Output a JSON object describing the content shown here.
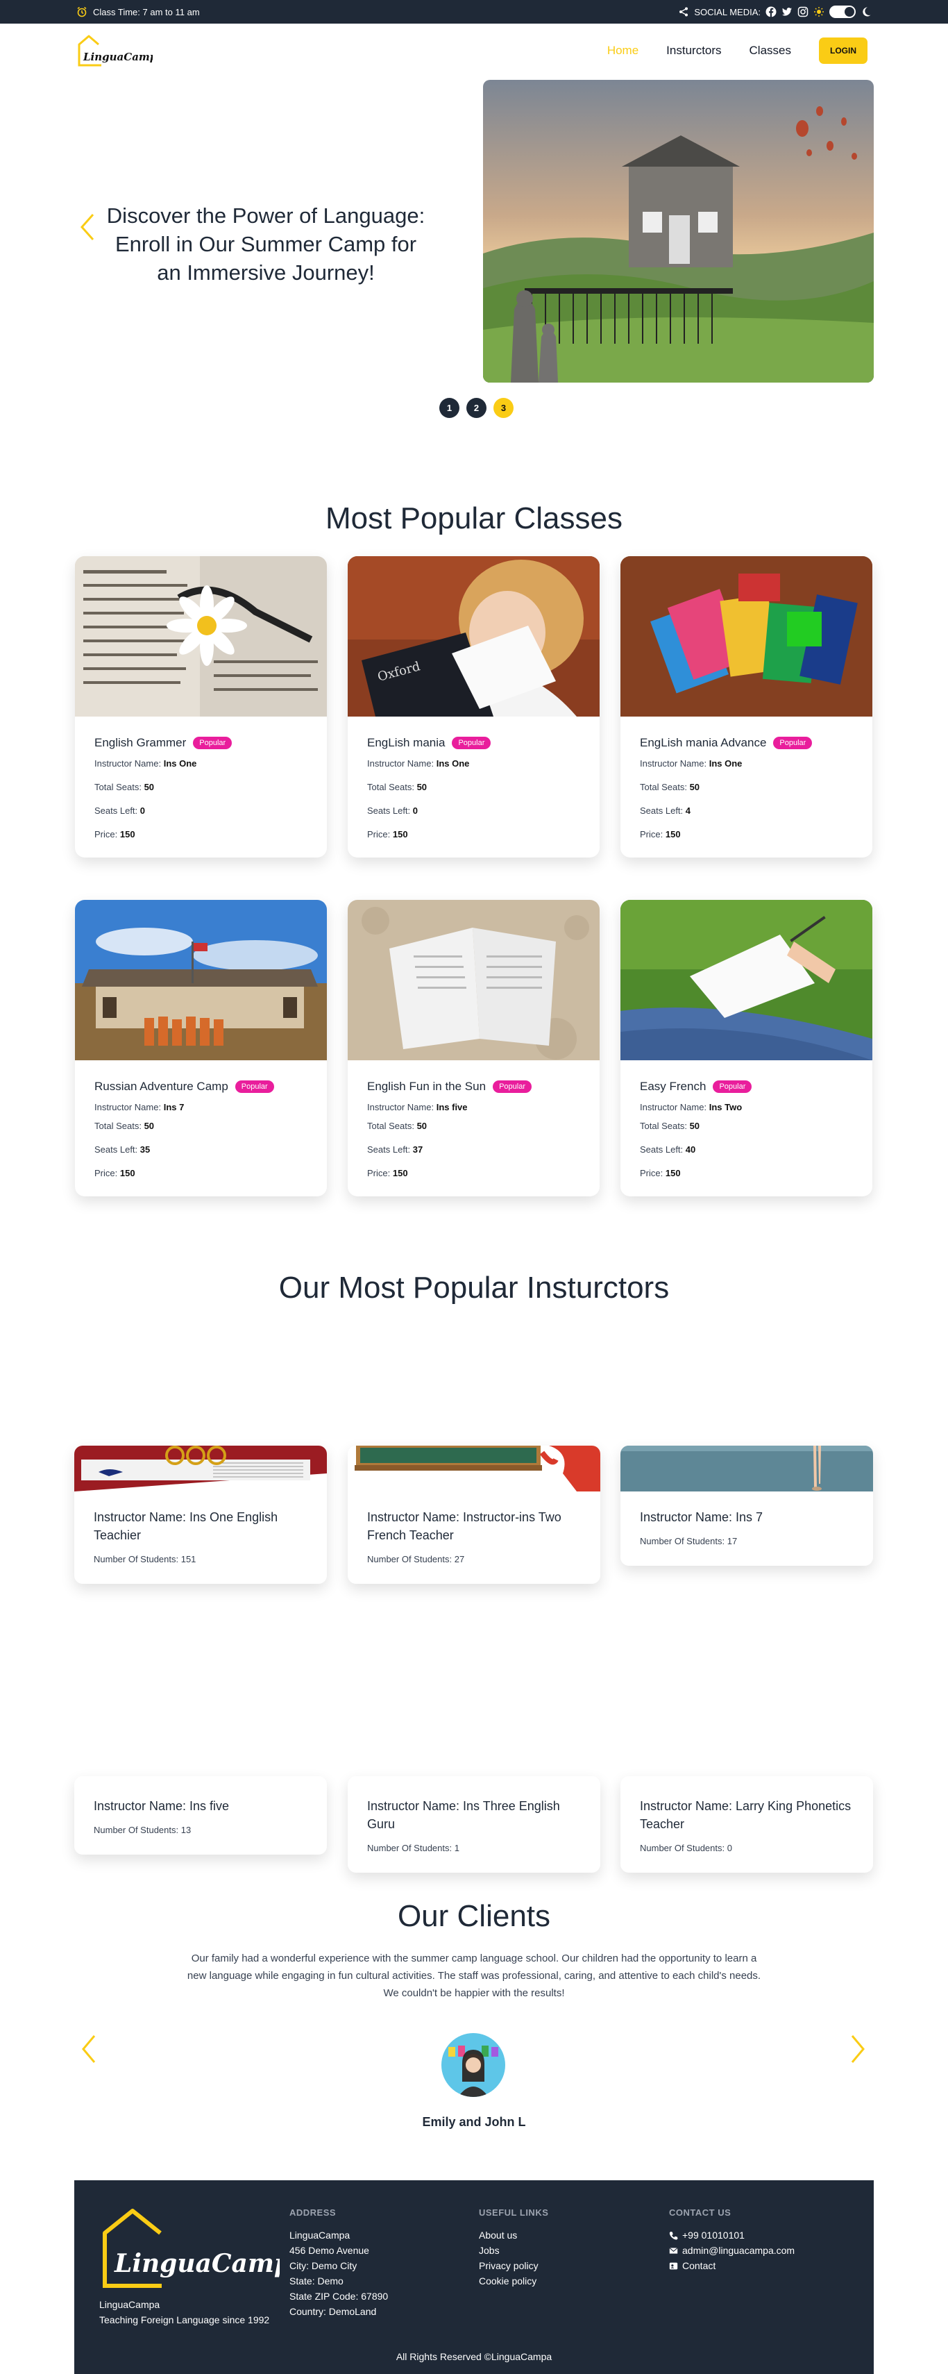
{
  "topbar": {
    "class_time": "Class Time: 7 am to 11 am",
    "social_label": "SOCIAL MEDIA:"
  },
  "nav": {
    "logo_text": "LinguaCampa",
    "links": [
      "Home",
      "Insturctors",
      "Classes"
    ],
    "login": "LOGIN"
  },
  "hero": {
    "headline": "Discover the Power of Language: Enroll in Our Summer Camp for an Immersive Journey!",
    "dots": [
      "1",
      "2",
      "3"
    ],
    "active_dot": 3
  },
  "classes": {
    "title": "Most Popular Classes",
    "labels": {
      "instructor": "Instructor Name:",
      "total": "Total Seats:",
      "left": "Seats Left:",
      "price": "Price:"
    },
    "items": [
      {
        "name": "English Grammer",
        "badge": "Popular",
        "instructor": "Ins One",
        "total": "50",
        "left": "0",
        "price": "150"
      },
      {
        "name": "EngLish mania",
        "badge": "Popular",
        "instructor": "Ins One",
        "total": "50",
        "left": "0",
        "price": "150"
      },
      {
        "name": "EngLish mania Advance",
        "badge": "Popular",
        "instructor": "Ins One",
        "total": "50",
        "left": "4",
        "price": "150"
      },
      {
        "name": "Russian Adventure Camp",
        "badge": "Popular",
        "instructor": "Ins 7",
        "total": "50",
        "left": "35",
        "price": "150"
      },
      {
        "name": "English Fun in the Sun",
        "badge": "Popular",
        "instructor": "Ins five",
        "total": "50",
        "left": "37",
        "price": "150"
      },
      {
        "name": "Easy French",
        "badge": "Popular",
        "instructor": "Ins Two",
        "total": "50",
        "left": "40",
        "price": "150"
      }
    ]
  },
  "instructors": {
    "title": "Our Most Popular Insturctors",
    "items": [
      {
        "name": "Instructor Name: Ins One English Teachier",
        "students": "Number Of Students: 151"
      },
      {
        "name": "Instructor Name: Instructor-ins Two French Teacher",
        "students": "Number Of Students: 27"
      },
      {
        "name": "Instructor Name: Ins 7",
        "students": "Number Of Students: 17"
      },
      {
        "name": "Instructor Name: Ins five",
        "students": "Number Of Students: 13"
      },
      {
        "name": "Instructor Name: Ins Three English Guru",
        "students": "Number Of Students: 1"
      },
      {
        "name": "Instructor Name: Larry King Phonetics Teacher",
        "students": "Number Of Students: 0"
      }
    ]
  },
  "clients": {
    "title": "Our Clients",
    "testimonial": "Our family had a wonderful experience with the summer camp language school. Our children had the opportunity to learn a new language while engaging in fun cultural activities. The staff was professional, caring, and attentive to each child's needs. We couldn't be happier with the results!",
    "name": "Emily and John L"
  },
  "footer": {
    "brand_name": "LinguaCampa",
    "brand_tagline": "Teaching Foreign Language since 1992",
    "address": {
      "heading": "ADDRESS",
      "lines": [
        "LinguaCampa",
        "456 Demo Avenue",
        "City: Demo City",
        "State: Demo",
        "State ZIP Code: 67890",
        "Country: DemoLand"
      ]
    },
    "links": {
      "heading": "USEFUL LINKS",
      "items": [
        "About us",
        "Jobs",
        "Privacy policy",
        "Cookie policy"
      ]
    },
    "contact": {
      "heading": "CONTACT US",
      "phone": "+99 01010101",
      "email": "admin@linguacampa.com",
      "contact": "Contact"
    },
    "copyright": "All Rights Reserved ©LinguaCampa"
  },
  "colors": {
    "accent": "#facc15",
    "dark": "#1f2937",
    "badge": "#e91e9c"
  }
}
